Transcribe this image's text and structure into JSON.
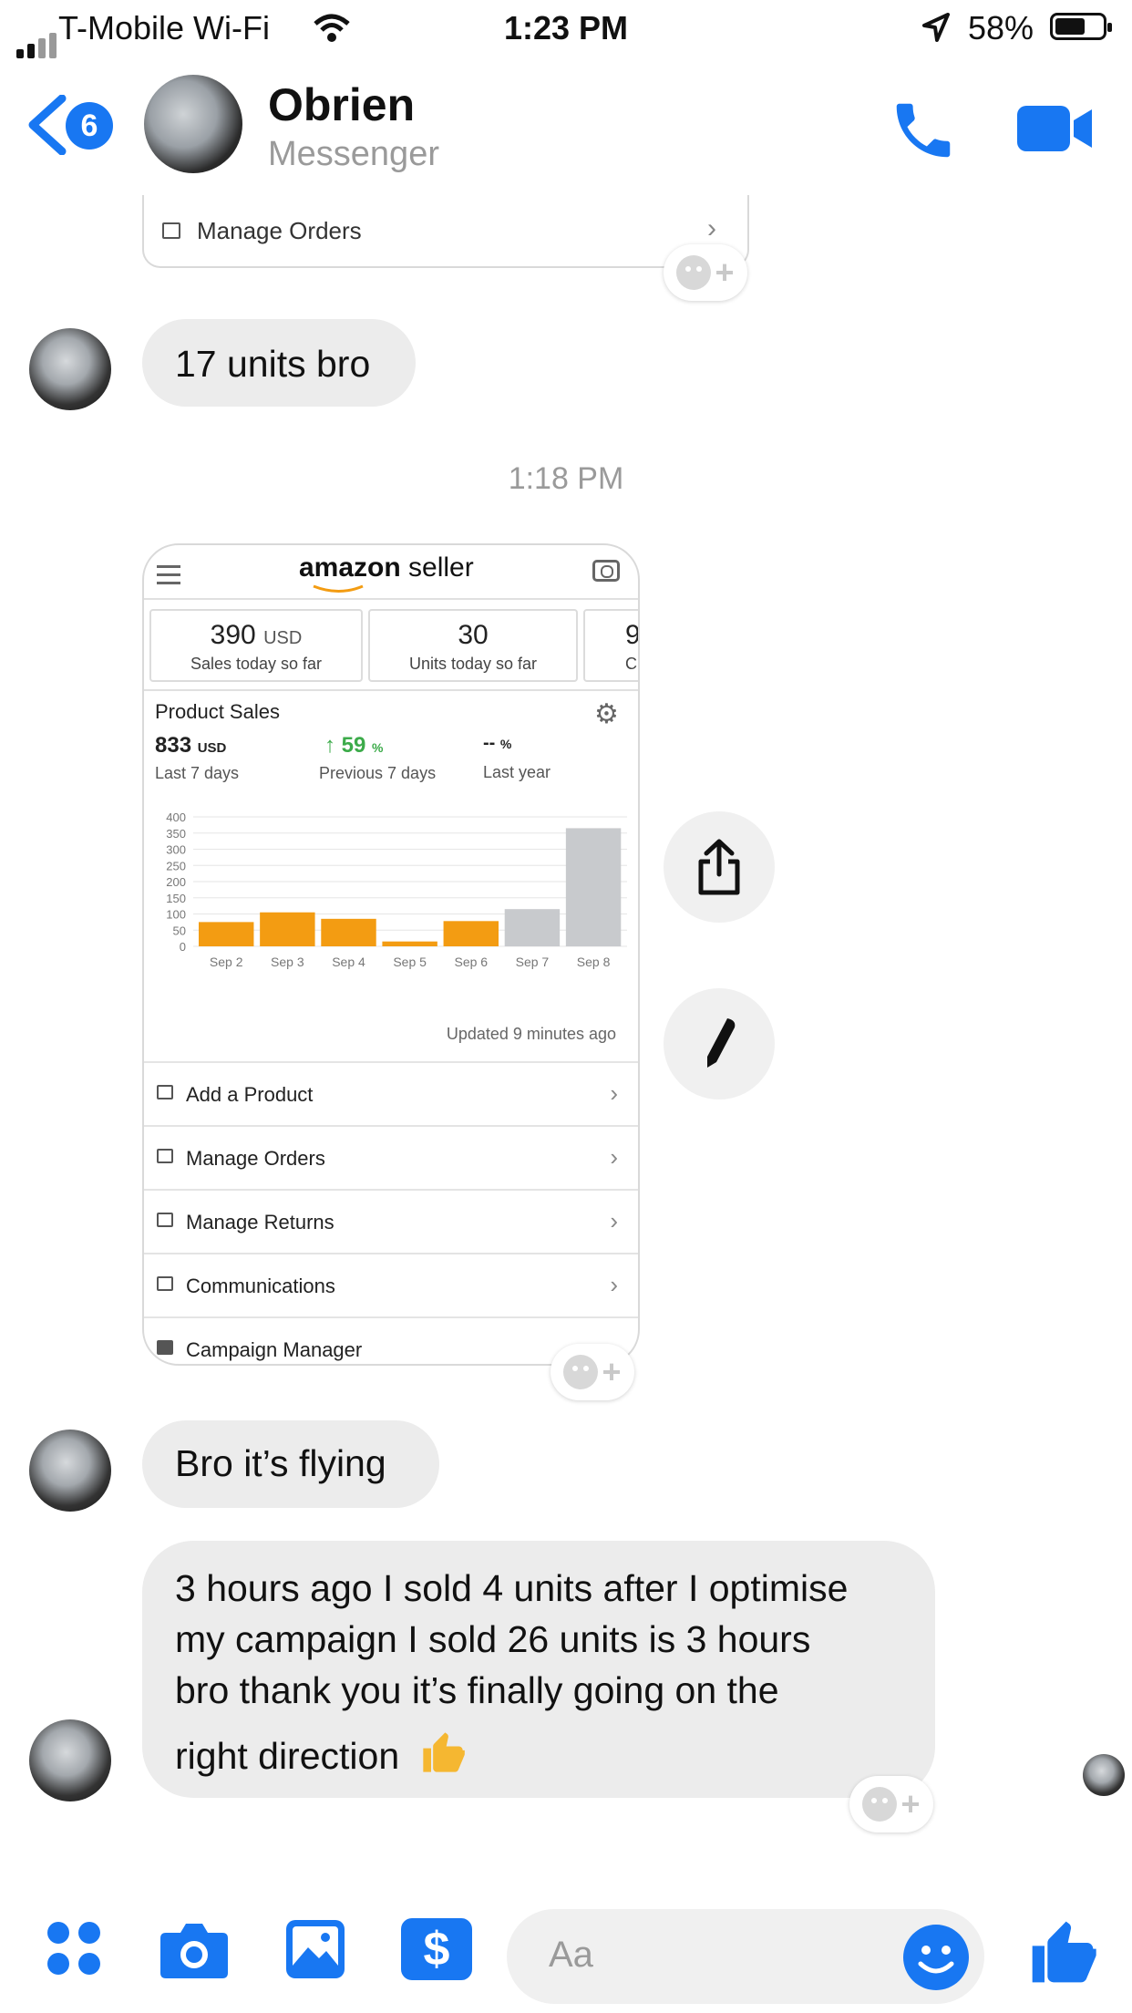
{
  "status_bar": {
    "carrier": "T-Mobile Wi-Fi",
    "time": "1:23 PM",
    "battery": "58%"
  },
  "header": {
    "back_count": "6",
    "name": "Obrien",
    "subtitle": "Messenger"
  },
  "top_card": {
    "row_label": "Manage Orders"
  },
  "messages": {
    "msg1": "17 units bro",
    "timestamp": "1:18 PM",
    "msg2": "Bro it’s flying",
    "msg3_line1": "3 hours ago I sold 4 units after I optimise",
    "msg3_line2": "my campaign I sold 26 units is 3 hours",
    "msg3_line3": "bro thank you it’s finally going on the",
    "msg3_line4": "right direction"
  },
  "seller_card": {
    "brand": "amazon",
    "brand_suffix": "seller",
    "kpis": [
      {
        "value": "390",
        "unit": "USD",
        "label": "Sales today so far"
      },
      {
        "value": "30",
        "unit": "",
        "label": "Units today so far"
      },
      {
        "value": "9",
        "unit": "",
        "label": "C"
      }
    ],
    "section_title": "Product Sales",
    "stats": [
      {
        "value": "833",
        "unit": "USD",
        "label": "Last 7 days"
      },
      {
        "value": "↑ 59",
        "unit": "%",
        "label": "Previous 7 days"
      },
      {
        "value": "--",
        "unit": "%",
        "label": "Last year"
      }
    ],
    "updated": "Updated 9 minutes ago",
    "rows": [
      "Add a Product",
      "Manage Orders",
      "Manage Returns",
      "Communications",
      "Campaign Manager"
    ]
  },
  "chart_data": {
    "type": "bar",
    "categories": [
      "Sep 2",
      "Sep 3",
      "Sep 4",
      "Sep 5",
      "Sep 6",
      "Sep 7",
      "Sep 8"
    ],
    "values": [
      75,
      105,
      85,
      15,
      78,
      115,
      365
    ],
    "yticks": [
      "0",
      "50",
      "100",
      "150",
      "200",
      "250",
      "300",
      "350",
      "400"
    ],
    "ylim": [
      0,
      400
    ],
    "colors": [
      "#f39c12",
      "#f39c12",
      "#f39c12",
      "#f39c12",
      "#f39c12",
      "#c8cacd",
      "#c8cacd"
    ],
    "grid": true
  },
  "composer": {
    "placeholder": "Aa"
  },
  "colors": {
    "accent": "#1877f2",
    "bubble": "#ececec",
    "thumb": "#f5b731"
  }
}
